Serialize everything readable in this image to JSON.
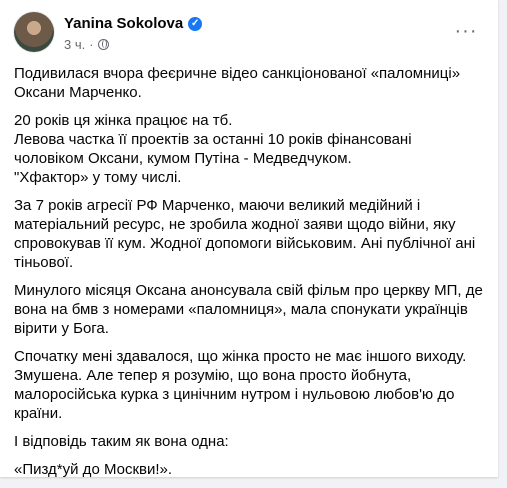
{
  "post": {
    "author": "Yanina Sokolova",
    "time": "3 ч.",
    "privacy_separator": "·",
    "more_label": "···",
    "paragraphs": [
      [
        "Подивилася вчора феєричне відео санкціонованої «паломниці»",
        "Оксани Марченко."
      ],
      [
        "20 років ця жінка працює на тб.",
        "Левова частка її проектів за останні 10 років фінансовані",
        "чоловіком Оксани, кумом Путіна - Медведчуком.",
        "\"Хфактор» у тому числі."
      ],
      [
        "За 7 років агресії РФ Марченко, маючи великий медійний і",
        "матеріальний ресурс, не зробила жодної заяви щодо війни, яку",
        "спровокував її кум. Жодної допомоги військовим. Ані публічної ані",
        "тіньової."
      ],
      [
        "Минулого місяця Оксана анонсувала свій фільм про церкву МП, де",
        "вона на бмв з номерами «паломниця», мала спонукати українців",
        "вірити у Бога."
      ],
      [
        "Спочатку мені здавалося, що жінка просто не має іншого виходу.",
        "Змушена. Але тепер я розумію, що вона просто йобнута,",
        "малоросійська курка з цинічним нутром і нульовою любов'ю до",
        "країни."
      ],
      [
        "І відповідь таким як вона одна:"
      ],
      [
        "«Пизд*уй до Москви!»."
      ]
    ]
  }
}
